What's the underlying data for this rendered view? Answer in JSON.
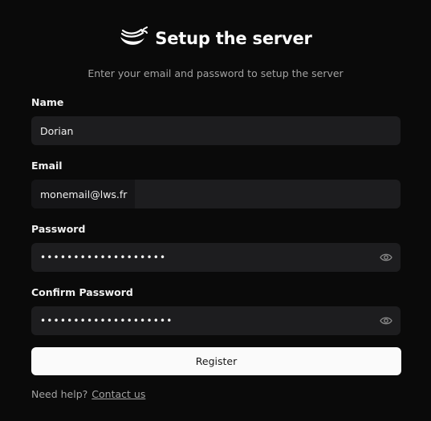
{
  "header": {
    "logo_icon": "whale-logo-icon",
    "title": "Setup the server",
    "subtitle": "Enter your email and password to setup the server"
  },
  "form": {
    "name": {
      "label": "Name",
      "value": "Dorian"
    },
    "email": {
      "label": "Email",
      "value": "monemail@lws.fr"
    },
    "password": {
      "label": "Password",
      "masked_value": "•••••••••••••••••••",
      "toggle_icon": "eye-icon"
    },
    "confirm_password": {
      "label": "Confirm Password",
      "masked_value": "••••••••••••••••••••",
      "toggle_icon": "eye-icon"
    },
    "submit_label": "Register"
  },
  "footer": {
    "help_text": "Need help?",
    "contact_link": "Contact us"
  },
  "colors": {
    "background": "#0a0a0a",
    "input_bg": "#1d1d1f",
    "button_bg": "#fafafa",
    "muted_text": "#a3a3a3"
  }
}
